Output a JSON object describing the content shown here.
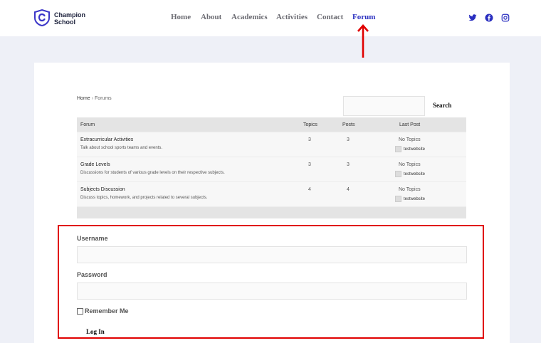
{
  "brand": {
    "line1": "Champion",
    "line2": "School"
  },
  "nav": [
    {
      "label": "Home"
    },
    {
      "label": "About"
    },
    {
      "label": "Academics"
    },
    {
      "label": "Activities"
    },
    {
      "label": "Contact"
    },
    {
      "label": "Forum",
      "active": true
    }
  ],
  "social": [
    "twitter-icon",
    "facebook-icon",
    "instagram-icon"
  ],
  "breadcrumb": {
    "home": "Home",
    "separator": "›",
    "current": "Forums"
  },
  "search": {
    "button_label": "Search",
    "placeholder": ""
  },
  "table": {
    "headers": {
      "forum": "Forum",
      "topics": "Topics",
      "posts": "Posts",
      "last_post": "Last Post"
    },
    "rows": [
      {
        "title": "Extracurricular Activities",
        "desc": "Talk about school sports teams and events.",
        "topics": "3",
        "posts": "3",
        "last": "No Topics",
        "author": "testwebsite"
      },
      {
        "title": "Grade Levels",
        "desc": "Discussions for students of various grade levels on their respective subjects.",
        "topics": "3",
        "posts": "3",
        "last": "No Topics",
        "author": "testwebsite"
      },
      {
        "title": "Subjects Discussion",
        "desc": "Discuss topics, homework, and projects related to several subjects.",
        "topics": "4",
        "posts": "4",
        "last": "No Topics",
        "author": "testwebsite"
      }
    ]
  },
  "login": {
    "username_label": "Username",
    "username_value": "",
    "password_label": "Password",
    "password_value": "",
    "remember_label": "Remember Me",
    "button_label": "Log In"
  },
  "colors": {
    "accent": "#2a2fc0",
    "highlight": "#e00000",
    "background": "#eef0f7"
  }
}
